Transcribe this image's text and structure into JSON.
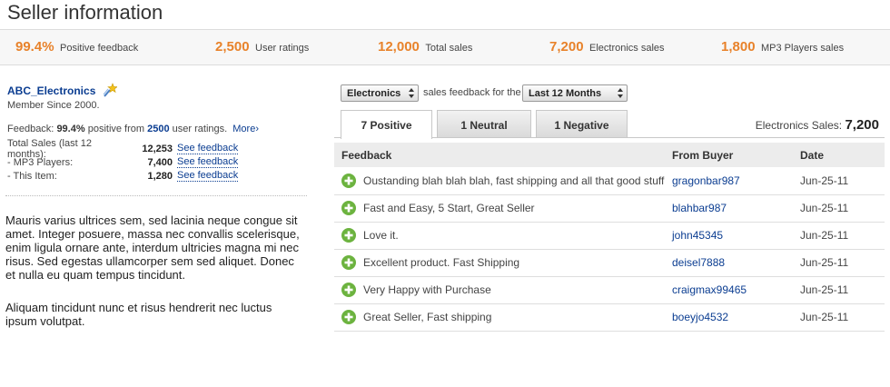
{
  "page": {
    "title": "Seller information"
  },
  "stats": [
    {
      "value": "99.4%",
      "label": "Positive feedback"
    },
    {
      "value": "2,500",
      "label": "User ratings"
    },
    {
      "value": "12,000",
      "label": "Total sales"
    },
    {
      "value": "7,200",
      "label": "Electronics sales"
    },
    {
      "value": "1,800",
      "label": "MP3 Players sales"
    }
  ],
  "seller": {
    "name": "ABC_Electronics",
    "member_since": "Member Since 2000.",
    "feedback_prefix": "Feedback:",
    "feedback_percent": "99.4%",
    "feedback_mid": "positive from",
    "feedback_count": "2500",
    "feedback_suffix": "user ratings.",
    "more_label": "More",
    "more_chevron": "›",
    "sales": [
      {
        "label": "Total Sales (last 12 months):",
        "value": "12,253",
        "link": "See feedback"
      },
      {
        "label": "- MP3 Players:",
        "value": "7,400",
        "link": "See feedback"
      },
      {
        "label": "- This Item:",
        "value": "1,280",
        "link": "See feedback"
      }
    ]
  },
  "description": [
    "Mauris varius ultrices sem, sed lacinia neque congue sit amet. Integer posuere, massa nec convallis scelerisque, enim ligula ornare ante, interdum ultricies magna mi nec risus. Sed egestas ullamcorper sem sed aliquet. Donec et nulla eu quam tempus tincidunt.",
    "Aliquam tincidunt nunc et risus hendrerit nec luctus ipsum volutpat."
  ],
  "filters": {
    "category": "Electronics",
    "between_text": "sales feedback for the",
    "period": "Last 12 Months"
  },
  "tabs": [
    {
      "label": "7 Positive",
      "active": true
    },
    {
      "label": "1 Neutral",
      "active": false
    },
    {
      "label": "1 Negative",
      "active": false
    }
  ],
  "electronics_sales": {
    "label": "Electronics Sales:",
    "value": "7,200"
  },
  "table": {
    "headers": [
      "Feedback",
      "From Buyer",
      "Date"
    ],
    "rows": [
      {
        "feedback": "Oustanding blah blah blah, fast shipping and all that good stuff",
        "buyer": "gragonbar987",
        "date": "Jun-25-11"
      },
      {
        "feedback": "Fast and Easy, 5 Start, Great Seller",
        "buyer": "blahbar987",
        "date": "Jun-25-11"
      },
      {
        "feedback": "Love it.",
        "buyer": "john45345",
        "date": "Jun-25-11"
      },
      {
        "feedback": "Excellent product. Fast Shipping",
        "buyer": "deisel7888",
        "date": "Jun-25-11"
      },
      {
        "feedback": "Very Happy with Purchase",
        "buyer": "craigmax99465",
        "date": "Jun-25-11"
      },
      {
        "feedback": "Great Seller, Fast shipping",
        "buyer": "boeyjo4532",
        "date": "Jun-25-11"
      }
    ],
    "row_icon": "plus-circle-icon"
  },
  "colors": {
    "accent_orange": "#e8822a",
    "link_blue": "#0b3d91",
    "positive_green": "#6cb33f"
  }
}
